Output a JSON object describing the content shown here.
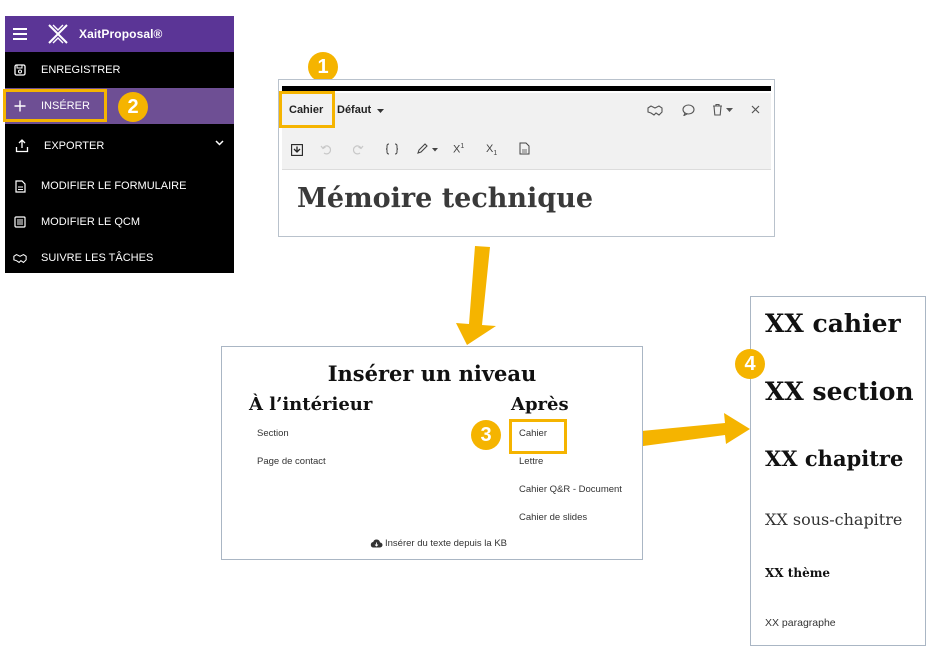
{
  "sidebar": {
    "brand": "XaitProposal®",
    "items": [
      {
        "label": "ENREGISTRER",
        "icon": "save-icon"
      },
      {
        "label": "INSÉRER",
        "icon": "plus-icon"
      },
      {
        "label": "EXPORTER",
        "icon": "export-icon"
      },
      {
        "label": "MODIFIER LE FORMULAIRE",
        "icon": "document-icon"
      },
      {
        "label": "MODIFIER LE QCM",
        "icon": "form-list-icon"
      },
      {
        "label": "SUIVRE LES TÂCHES",
        "icon": "handshake-icon"
      }
    ]
  },
  "editor": {
    "tab_label": "Cahier",
    "style_label": "Défaut",
    "heading": "Mémoire technique",
    "superscript_label": "X",
    "superscript_mark": "1",
    "subscript_label": "X",
    "subscript_mark": "1"
  },
  "dialog": {
    "title": "Insérer un niveau",
    "inside_heading": "À l’intérieur",
    "after_heading": "Après",
    "inside_items": [
      "Section",
      "Page de contact"
    ],
    "after_items": [
      "Cahier",
      "Lettre",
      "Cahier Q&R - Document",
      "Cahier de slides"
    ],
    "kb_link": "Insérer du texte depuis la KB"
  },
  "levels": {
    "items": [
      "XX cahier",
      "XX section",
      "XX chapitre",
      "XX sous-chapitre",
      "XX thème",
      "XX paragraphe"
    ]
  },
  "badges": [
    "1",
    "2",
    "3",
    "4"
  ],
  "colors": {
    "accent": "#f5b400",
    "sidebar_bg": "#000000",
    "sidebar_header": "#5b3596",
    "sidebar_active": "#6e4f94"
  }
}
